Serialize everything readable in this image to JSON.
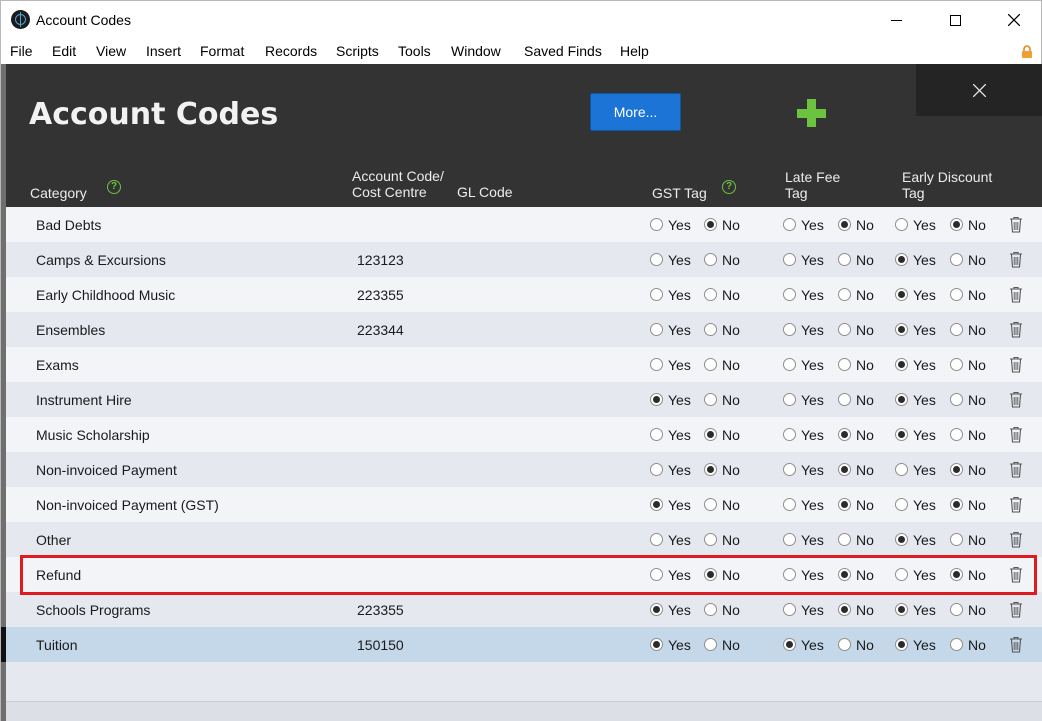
{
  "window": {
    "title": "Account Codes",
    "menu": [
      "File",
      "Edit",
      "View",
      "Insert",
      "Format",
      "Records",
      "Scripts",
      "Tools",
      "Window",
      "Saved Finds",
      "Help"
    ]
  },
  "header": {
    "title": "Account Codes",
    "more_label": "More...",
    "columns": {
      "category": "Category",
      "account_code_1": "Account Code/",
      "account_code_2": "Cost Centre",
      "gl_code": "GL Code",
      "gst_tag": "GST Tag",
      "late_fee_1": "Late Fee",
      "late_fee_2": "Tag",
      "early_discount_1": "Early Discount",
      "early_discount_2": "Tag"
    },
    "help_glyph": "?"
  },
  "labels": {
    "yes": "Yes",
    "no": "No"
  },
  "rows": [
    {
      "category": "Bad Debts",
      "code": "",
      "gst": "No",
      "late_fee": "No",
      "early_discount": "No"
    },
    {
      "category": "Camps & Excursions",
      "code": "123123",
      "gst": "",
      "late_fee": "",
      "early_discount": "Yes"
    },
    {
      "category": "Early Childhood Music",
      "code": "223355",
      "gst": "",
      "late_fee": "",
      "early_discount": "Yes"
    },
    {
      "category": "Ensembles",
      "code": "223344",
      "gst": "",
      "late_fee": "",
      "early_discount": "Yes"
    },
    {
      "category": "Exams",
      "code": "",
      "gst": "",
      "late_fee": "",
      "early_discount": "Yes"
    },
    {
      "category": "Instrument Hire",
      "code": "",
      "gst": "Yes",
      "late_fee": "",
      "early_discount": "Yes"
    },
    {
      "category": "Music Scholarship",
      "code": "",
      "gst": "No",
      "late_fee": "No",
      "early_discount": "Yes"
    },
    {
      "category": "Non-invoiced Payment",
      "code": "",
      "gst": "No",
      "late_fee": "No",
      "early_discount": "No"
    },
    {
      "category": "Non-invoiced Payment (GST)",
      "code": "",
      "gst": "Yes",
      "late_fee": "No",
      "early_discount": "No"
    },
    {
      "category": "Other",
      "code": "",
      "gst": "",
      "late_fee": "",
      "early_discount": "Yes"
    },
    {
      "category": "Refund",
      "code": "",
      "gst": "No",
      "late_fee": "No",
      "early_discount": "No"
    },
    {
      "category": "Schools Programs",
      "code": "223355",
      "gst": "Yes",
      "late_fee": "No",
      "early_discount": "Yes"
    },
    {
      "category": "Tuition",
      "code": "150150",
      "gst": "Yes",
      "late_fee": "Yes",
      "early_discount": "Yes"
    }
  ],
  "selected_row": "Tuition",
  "highlighted_row": "Refund",
  "colors": {
    "header_bg": "#333333",
    "more_button": "#1b74d6",
    "add_icon": "#6bc33f",
    "highlight_border": "#e01a21",
    "selected_row": "#c4d8ea"
  }
}
